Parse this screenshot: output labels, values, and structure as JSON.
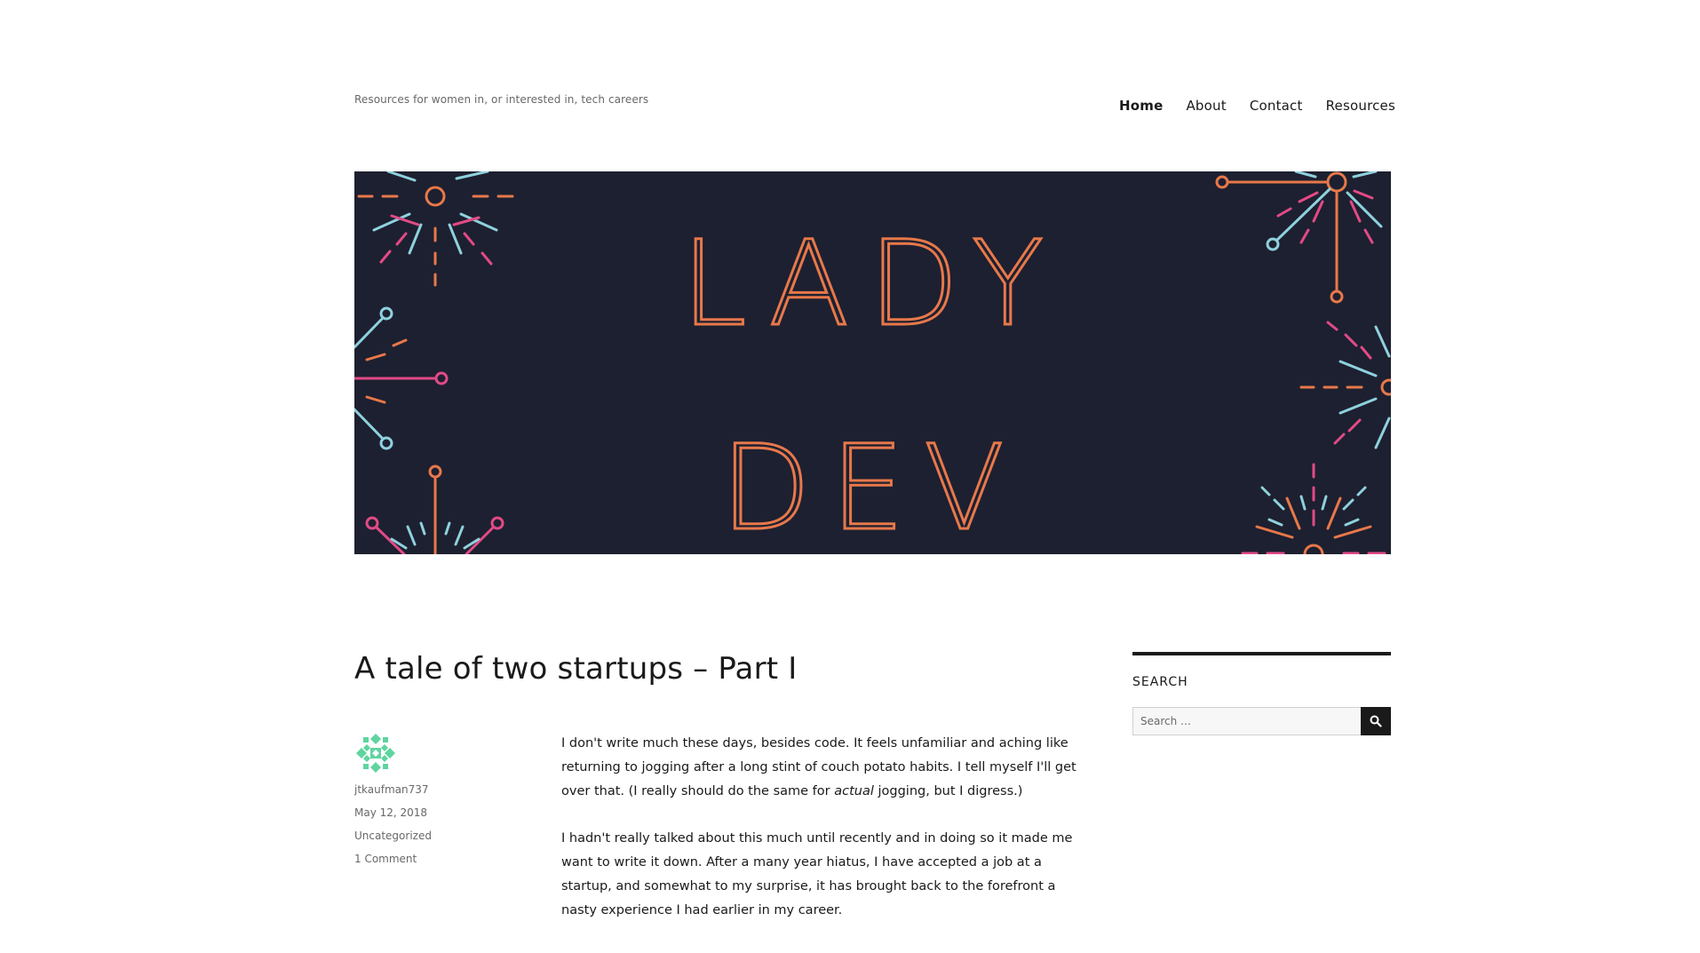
{
  "site": {
    "tagline": "Resources for women in, or interested in, tech careers"
  },
  "nav": {
    "items": [
      {
        "label": "Home",
        "active": true
      },
      {
        "label": "About",
        "active": false
      },
      {
        "label": "Contact",
        "active": false
      },
      {
        "label": "Resources",
        "active": false
      }
    ]
  },
  "banner": {
    "line1": "LADY",
    "line2": "DEV",
    "colors": {
      "background": "#1d2030",
      "orange": "#e8784a",
      "pink": "#e24a86",
      "blue": "#8fd1de"
    }
  },
  "post": {
    "title": "A tale of two startups – Part I",
    "author": "jtkaufman737",
    "date": "May 12, 2018",
    "category": "Uncategorized",
    "comments": "1 Comment",
    "p1_a": "I don't write much these days, besides code. It feels unfamiliar and aching like returning to jogging after a long stint of couch potato habits. I tell myself I'll get over that. (I really should do the same for ",
    "p1_em": "actual",
    "p1_b": " jogging, but I digress.)",
    "p2": "I hadn't really talked about this much until recently and in doing so it made me want to write it down. After a many year hiatus, I have accepted a job at a startup, and somewhat to my surprise, it has brought back to the forefront a nasty experience I had earlier in my career."
  },
  "sidebar": {
    "widget_title": "SEARCH",
    "search_placeholder": "Search …",
    "search_icon": "search-icon"
  }
}
